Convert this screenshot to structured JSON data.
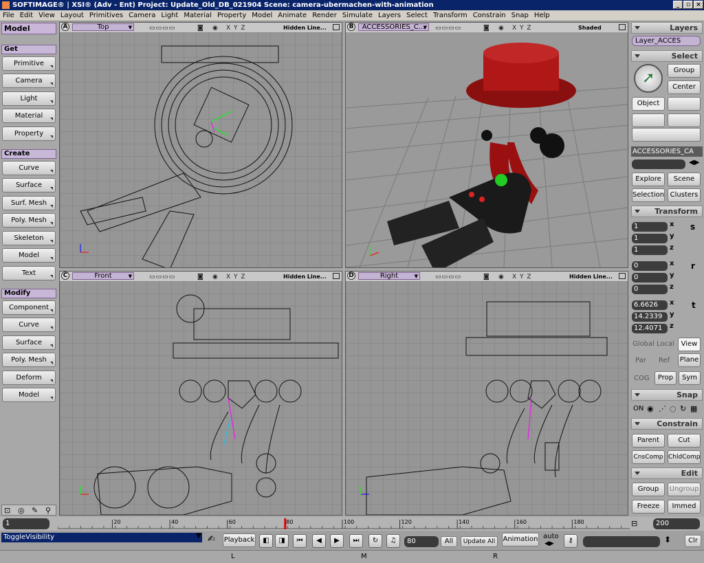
{
  "window": {
    "title": "SOFTIMAGE® | XSI® (Adv - Ent) Project: Update_Old_DB_021904    Scene: camera-ubermachen-with-animation",
    "min": "_",
    "max": "▫",
    "close": "×"
  },
  "menu": [
    "File",
    "Edit",
    "View",
    "Layout",
    "Primitives",
    "Camera",
    "Light",
    "Material",
    "Property",
    "Model",
    "Animate",
    "Render",
    "Simulate",
    "Layers",
    "Select",
    "Transform",
    "Constrain",
    "Snap",
    "Help"
  ],
  "left": {
    "title": "Model",
    "get": {
      "label": "Get",
      "items": [
        "Primitive",
        "Camera",
        "Light",
        "Material",
        "Property"
      ]
    },
    "create": {
      "label": "Create",
      "items": [
        "Curve",
        "Surface",
        "Surf. Mesh",
        "Poly. Mesh",
        "Skeleton",
        "Model",
        "Text"
      ]
    },
    "modify": {
      "label": "Modify",
      "items": [
        "Component",
        "Curve",
        "Surface",
        "Poly. Mesh",
        "Deform",
        "Model"
      ]
    }
  },
  "viewports": [
    {
      "letter": "A",
      "name": "Top",
      "mode": "Hidden Line...",
      "axes": "X Y Z"
    },
    {
      "letter": "B",
      "name": "ACCESSORIES_C...",
      "mode": "Shaded",
      "axes": "X Y Z"
    },
    {
      "letter": "C",
      "name": "Front",
      "mode": "Hidden Line...",
      "axes": "X Y Z"
    },
    {
      "letter": "D",
      "name": "Right",
      "mode": "Hidden Line...",
      "axes": "X Y Z"
    }
  ],
  "right": {
    "layers_label": "Layers",
    "layer_value": "Layer_ACCES",
    "select_label": "Select",
    "group": "Group",
    "center": "Center",
    "object": "Object",
    "selection_name": "ACCESSORIES_CA",
    "explore": "Explore",
    "scene": "Scene",
    "selection": "Selection",
    "clusters": "Clusters",
    "transform_label": "Transform",
    "scale": [
      "1",
      "1",
      "1"
    ],
    "rotate": [
      "0",
      "0",
      "0"
    ],
    "translate": [
      "6.6626",
      "14.2339",
      "12.4071"
    ],
    "axis_x": "x",
    "axis_y": "y",
    "axis_z": "z",
    "s_icon": "s",
    "r_icon": "r",
    "t_icon": "t",
    "global": "Global",
    "local": "Local",
    "view": "View",
    "par": "Par",
    "ref": "Ref",
    "plane": "Plane",
    "cog": "COG",
    "prop": "Prop",
    "sym": "Sym",
    "snap_label": "Snap",
    "snap_on": "ON",
    "constrain_label": "Constrain",
    "parent": "Parent",
    "cut": "Cut",
    "cnscomp": "CnsComp",
    "chldcomp": "ChldComp",
    "edit_label": "Edit",
    "egroup": "Group",
    "ungroup": "Ungroup",
    "freeze": "Freeze",
    "immed": "Immed"
  },
  "timeline": {
    "start": "1",
    "end": "200",
    "ticks": [
      "20",
      "40",
      "60",
      "80",
      "100",
      "120",
      "140",
      "160",
      "180"
    ],
    "current_frame": 80,
    "range_min": 1,
    "range_max": 200
  },
  "bottom": {
    "command": "ToggleVisibility",
    "playback": "Playback",
    "frame": "80",
    "all": "All",
    "update_all": "Update All",
    "animation": "Animation",
    "auto": "auto",
    "clr": "Clr"
  },
  "status": {
    "l": "L",
    "m": "M",
    "r": "R"
  }
}
